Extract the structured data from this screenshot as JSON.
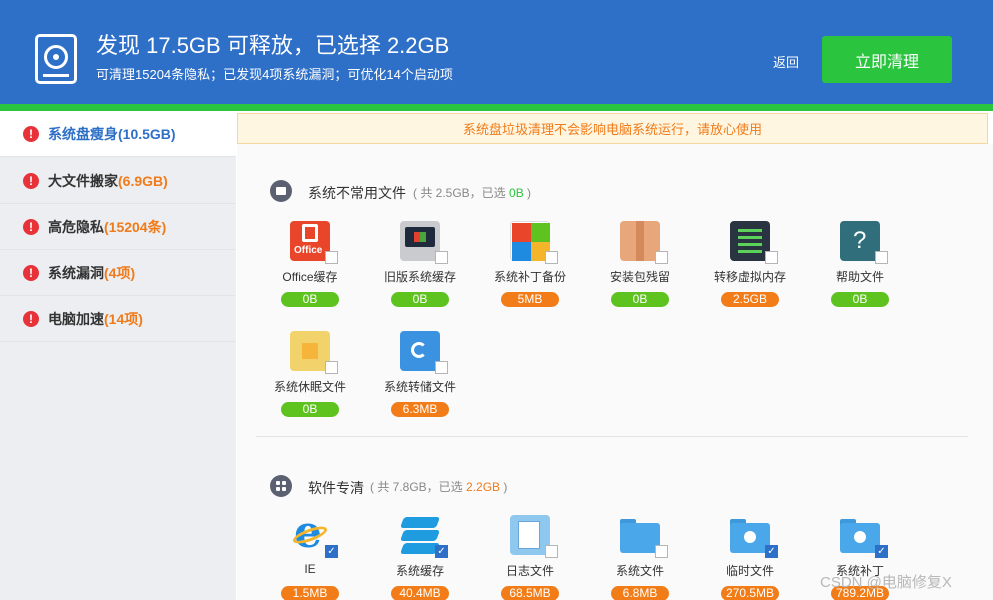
{
  "header": {
    "title": "发现 17.5GB 可释放，已选择 2.2GB",
    "subtitle": "可清理15204条隐私；已发现4项系统漏洞；可优化14个启动项",
    "back_label": "返回",
    "clean_label": "立即清理",
    "icon": "disk-icon"
  },
  "colors": {
    "header_bg": "#2e6fc7",
    "accent_green": "#2bc43f",
    "accent_orange": "#f07b1a",
    "alert_red": "#e8323a"
  },
  "sidebar": {
    "items": [
      {
        "label": "系统盘瘦身",
        "value": "(10.5GB)",
        "active": true
      },
      {
        "label": "大文件搬家",
        "value": "(6.9GB)",
        "active": false
      },
      {
        "label": "高危隐私",
        "value": "(15204条)",
        "active": false
      },
      {
        "label": "系统漏洞",
        "value": "(4项)",
        "active": false
      },
      {
        "label": "电脑加速",
        "value": "(14项)",
        "active": false
      }
    ]
  },
  "notice": "系统盘垃圾清理不会影响电脑系统运行，请放心使用",
  "sections": [
    {
      "title": "系统不常用文件",
      "meta_prefix": "( 共 2.5GB，已选 ",
      "meta_selected": "0B",
      "meta_suffix": " )",
      "items": [
        {
          "name": "Office缓存",
          "size": "0B",
          "icon": "office-icon",
          "checked": false,
          "icon_text": "Office"
        },
        {
          "name": "旧版系统缓存",
          "size": "0B",
          "icon": "old-windows-icon",
          "checked": false
        },
        {
          "name": "系统补丁备份",
          "size": "5MB",
          "icon": "patch-icon",
          "checked": false
        },
        {
          "name": "安装包残留",
          "size": "0B",
          "icon": "package-icon",
          "checked": false
        },
        {
          "name": "转移虚拟内存",
          "size": "2.5GB",
          "icon": "virtual-memory-icon",
          "checked": false
        },
        {
          "name": "帮助文件",
          "size": "0B",
          "icon": "help-icon",
          "checked": false,
          "icon_text": "?"
        },
        {
          "name": "系统休眠文件",
          "size": "0B",
          "icon": "hibernate-icon",
          "checked": false
        },
        {
          "name": "系统转储文件",
          "size": "6.3MB",
          "icon": "dump-icon",
          "checked": false
        }
      ]
    },
    {
      "title": "软件专清",
      "meta_prefix": "( 共 7.8GB，已选 ",
      "meta_selected": "2.2GB",
      "meta_suffix": " )",
      "items": [
        {
          "name": "IE",
          "size": "1.5MB",
          "icon": "ie-icon",
          "checked": true,
          "icon_text": "e"
        },
        {
          "name": "系统缓存",
          "size": "40.4MB",
          "icon": "stack-icon",
          "checked": true
        },
        {
          "name": "日志文件",
          "size": "68.5MB",
          "icon": "log-icon",
          "checked": false
        },
        {
          "name": "系统文件",
          "size": "6.8MB",
          "icon": "system-folder-icon",
          "checked": false
        },
        {
          "name": "临时文件",
          "size": "270.5MB",
          "icon": "temp-folder-icon",
          "checked": true
        },
        {
          "name": "系统补丁",
          "size": "789.2MB",
          "icon": "patch-folder-icon",
          "checked": true
        }
      ]
    }
  ],
  "watermark": "CSDN @电脑修复X"
}
